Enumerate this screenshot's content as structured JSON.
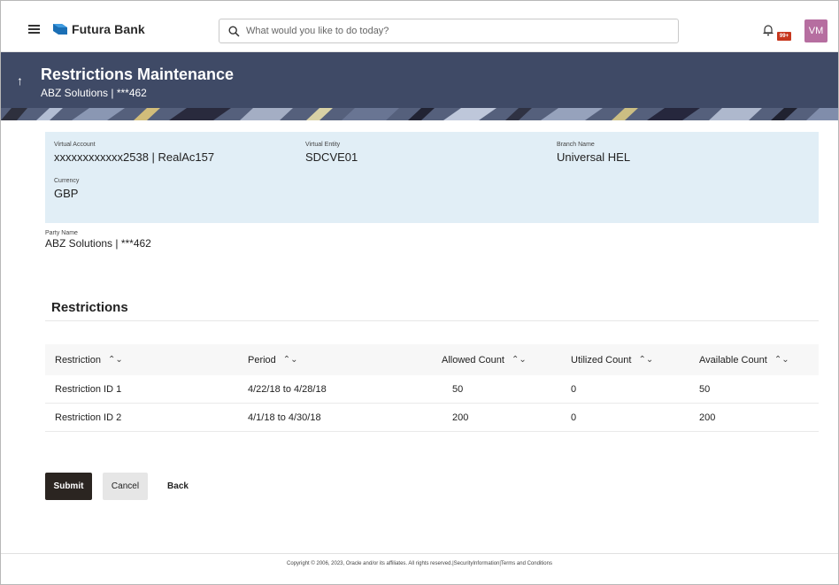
{
  "header": {
    "brand": "Futura Bank",
    "search_placeholder": "What would you like to do today?",
    "notification_badge": "99+",
    "avatar_initials": "VM"
  },
  "banner": {
    "title": "Restrictions Maintenance",
    "subtitle": "ABZ Solutions | ***462"
  },
  "account_details": {
    "virtual_account": {
      "label": "Virtual Account",
      "value": "xxxxxxxxxxxx2538 | RealAc157"
    },
    "virtual_entity": {
      "label": "Virtual Entity",
      "value": "SDCVE01"
    },
    "branch_name": {
      "label": "Branch Name",
      "value": "Universal HEL"
    },
    "currency": {
      "label": "Currency",
      "value": "GBP"
    }
  },
  "party": {
    "label": "Party Name",
    "value": "ABZ Solutions | ***462"
  },
  "restrictions": {
    "title": "Restrictions",
    "columns": [
      "Restriction",
      "Period",
      "Allowed Count",
      "Utilized Count",
      "Available Count"
    ],
    "rows": [
      [
        "Restriction ID 1",
        "4/22/18 to 4/28/18",
        "50",
        "0",
        "50"
      ],
      [
        "Restriction ID 2",
        "4/1/18 to 4/30/18",
        "200",
        "0",
        "200"
      ]
    ]
  },
  "actions": {
    "submit": "Submit",
    "cancel": "Cancel",
    "back": "Back"
  },
  "footer": {
    "text": "Copyright © 2006, 2023, Oracle and/or its affiliates. All rights reserved.|SecurityInformation|Terms and Conditions"
  },
  "colors": {
    "banner": "#3f4a66",
    "panel": "#e1eef6",
    "primary_button": "#2b2521",
    "avatar": "#b66ea0",
    "badge": "#c7381f"
  },
  "icons": [
    "menu-icon",
    "bank-logo-icon",
    "search-icon",
    "bell-icon",
    "back-arrow-icon",
    "sort-icon"
  ]
}
